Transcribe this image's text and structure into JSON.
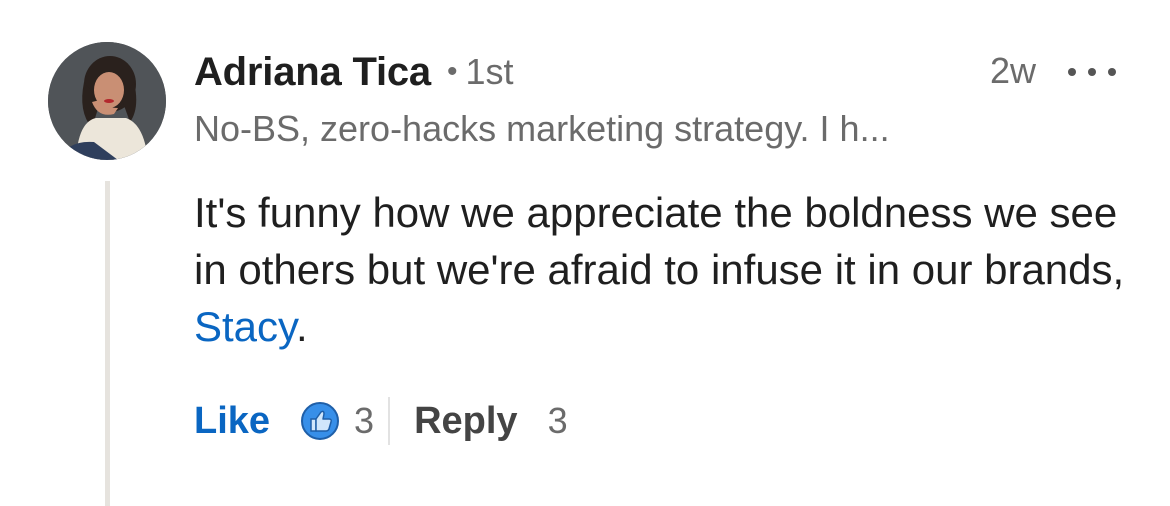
{
  "comment": {
    "author_name": "Adriana Tica",
    "separator": "•",
    "connection_degree": "1st",
    "timestamp": "2w",
    "headline": "No-BS, zero-hacks marketing strategy. I h...",
    "body_before_mention": "It's funny how we appreciate the boldness we see in others but we're afraid to infuse it in our brands, ",
    "mention": "Stacy",
    "body_after_mention": ".",
    "actions": {
      "like_label": "Like",
      "reaction_icon": "thumbs-up-icon",
      "like_count": "3",
      "reply_label": "Reply",
      "reply_count": "3"
    },
    "colors": {
      "link_blue": "#0a66c2",
      "secondary_text": "#6b6b6b",
      "primary_text": "#1f1f1f",
      "thread_line": "#e6e3de"
    }
  }
}
